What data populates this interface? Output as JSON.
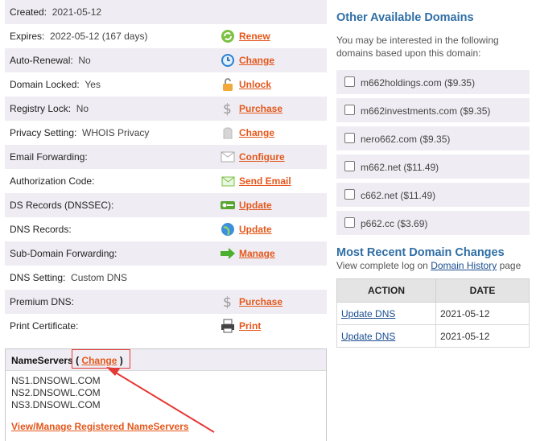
{
  "details": [
    {
      "label": "Created:",
      "value": "2021-05-12",
      "action": "",
      "icon": ""
    },
    {
      "label": "Expires:",
      "value": "2022-05-12 (167 days)",
      "action": "Renew",
      "icon": "renew-icon"
    },
    {
      "label": "Auto-Renewal:",
      "value": "No",
      "action": "Change",
      "icon": "clock-icon"
    },
    {
      "label": "Domain Locked:",
      "value": "Yes",
      "action": "Unlock",
      "icon": "lock-icon"
    },
    {
      "label": "Registry Lock:",
      "value": "No",
      "action": "Purchase",
      "icon": "dollar-icon"
    },
    {
      "label": "Privacy Setting:",
      "value": "WHOIS Privacy",
      "action": "Change",
      "icon": "privacy-icon"
    },
    {
      "label": "Email Forwarding:",
      "value": "",
      "action": "Configure",
      "icon": "envelope-icon"
    },
    {
      "label": "Authorization Code:",
      "value": "",
      "action": "Send Email",
      "icon": "send-mail-icon"
    },
    {
      "label": "DS Records (DNSSEC):",
      "value": "",
      "action": "Update",
      "icon": "key-icon"
    },
    {
      "label": "DNS Records:",
      "value": "",
      "action": "Update",
      "icon": "globe-icon"
    },
    {
      "label": "Sub-Domain Forwarding:",
      "value": "",
      "action": "Manage",
      "icon": "arrow-right-icon"
    },
    {
      "label": "DNS Setting:",
      "value": "Custom DNS",
      "action": "",
      "icon": ""
    },
    {
      "label": "Premium DNS:",
      "value": "",
      "action": "Purchase",
      "icon": "dollar-icon"
    },
    {
      "label": "Print Certificate:",
      "value": "",
      "action": "Print",
      "icon": "printer-icon"
    }
  ],
  "nameservers": {
    "title": "NameServers",
    "open_paren": "(",
    "change_label": "Change",
    "close_paren": ")",
    "list": [
      "NS1.DNSOWL.COM",
      "NS2.DNSOWL.COM",
      "NS3.DNSOWL.COM"
    ],
    "manage_link": "View/Manage Registered NameServers"
  },
  "other_domains": {
    "title": "Other Available Domains",
    "desc_line1": "You may be interested in the following",
    "desc_line2": "domains based upon this domain:",
    "items": [
      {
        "label": "m662holdings.com ($9.35)",
        "checked": false
      },
      {
        "label": "m662investments.com ($9.35)",
        "checked": false
      },
      {
        "label": "nero662.com ($9.35)",
        "checked": false
      },
      {
        "label": "m662.net ($11.49)",
        "checked": false
      },
      {
        "label": "c662.net ($11.49)",
        "checked": false
      },
      {
        "label": "p662.cc ($3.69)",
        "checked": false
      }
    ]
  },
  "recent_changes": {
    "title": "Most Recent Domain Changes",
    "desc_prefix": "View complete log on",
    "history_link": "Domain History",
    "desc_suffix": "page",
    "columns": [
      "ACTION",
      "DATE"
    ],
    "rows": [
      {
        "action": "Update DNS",
        "date": "2021-05-12"
      },
      {
        "action": "Update DNS",
        "date": "2021-05-12"
      }
    ]
  },
  "colors": {
    "action_orange": "#e4571b",
    "title_blue": "#2f6ea5",
    "row_shade": "#efedf3",
    "highlight_red": "#e53935"
  }
}
